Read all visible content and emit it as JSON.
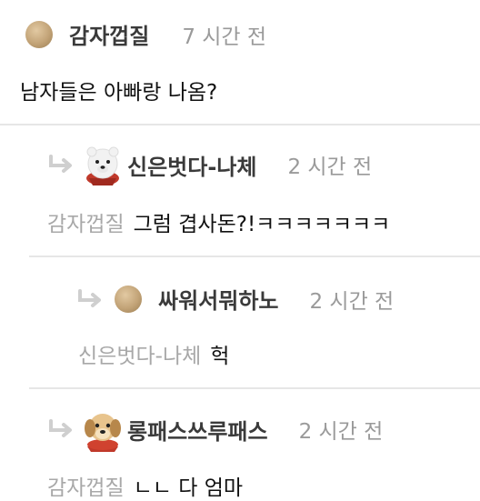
{
  "comments": [
    {
      "author": "감자껍질",
      "time": "7 시간 전",
      "mention": "",
      "text": "남자들은 아빠랑 나옴?",
      "avatar": "potato-avatar-icon"
    },
    {
      "author": "신은벗다-나체",
      "time": "2 시간 전",
      "mention": "감자껍질",
      "text": "그럼 겹사돈?!ㅋㅋㅋㅋㅋㅋㅋ",
      "avatar": "polar-bear-avatar-icon"
    },
    {
      "author": "싸워서뭐하노",
      "time": "2 시간 전",
      "mention": "신은벗다-나체",
      "text": "헉",
      "avatar": "potato-avatar-icon"
    },
    {
      "author": "롱패스쓰루패스",
      "time": "2 시간 전",
      "mention": "감자껍질",
      "text": "ㄴㄴ 다 엄마",
      "avatar": "puppy-avatar-icon"
    }
  ],
  "icons": {
    "reply": "reply-arrow-icon"
  }
}
